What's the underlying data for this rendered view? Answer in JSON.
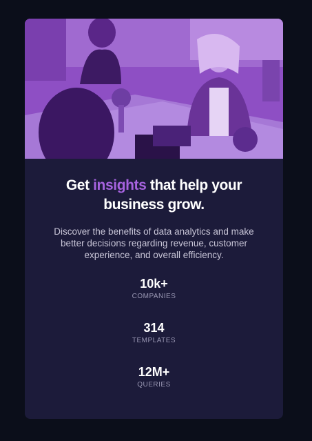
{
  "card": {
    "image": "office-team-photo",
    "headline": {
      "before": "Get ",
      "accent": "insights",
      "after": " that help your business grow."
    },
    "description": "Discover the benefits of data analytics and make better decisions regarding revenue, customer experience, and overall efficiency.",
    "stats": [
      {
        "value": "10k+",
        "label": "COMPANIES"
      },
      {
        "value": "314",
        "label": "TEMPLATES"
      },
      {
        "value": "12M+",
        "label": "QUERIES"
      }
    ]
  },
  "colors": {
    "page_background": "#0b0e1a",
    "card_background": "#1c1b3a",
    "accent": "#a763e0",
    "image_overlay": "#8a4bbf"
  }
}
